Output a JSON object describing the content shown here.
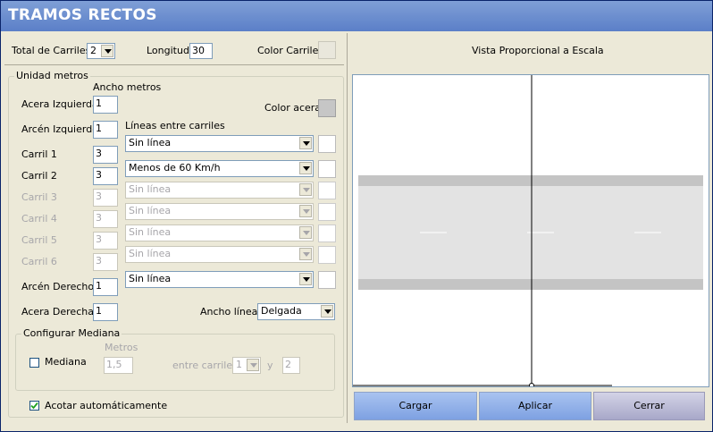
{
  "window": {
    "title": "TRAMOS RECTOS"
  },
  "top": {
    "total_carriles_label": "Total de Carriles:",
    "total_carriles_value": "2",
    "longitud_label": "Longitud:",
    "longitud_value": "30",
    "color_carriles_label": "Color Carriles:",
    "vista_label": "Vista Proporcional a Escala"
  },
  "unidad": {
    "caption": "Unidad metros",
    "ancho_header": "Ancho metros",
    "color_acera_label": "Color acera",
    "lineas_header": "Líneas entre carriles",
    "rows": [
      {
        "label": "Acera Izquierda",
        "value": "1"
      },
      {
        "label": "Arcén Izquierdo",
        "value": "1"
      },
      {
        "label": "Carril 1",
        "value": "3"
      },
      {
        "label": "Carril 2",
        "value": "3"
      },
      {
        "label": "Carril 3",
        "value": "3"
      },
      {
        "label": "Carril 4",
        "value": "3"
      },
      {
        "label": "Carril 5",
        "value": "3"
      },
      {
        "label": "Carril 6",
        "value": "3"
      },
      {
        "label": "Arcén Derecho",
        "value": "1"
      },
      {
        "label": "Acera Derecha",
        "value": "1"
      }
    ],
    "lineas": [
      "Sin línea",
      "Menos de 60 Km/h",
      "Sin línea",
      "Sin línea",
      "Sin línea",
      "Sin línea",
      "Sin línea"
    ],
    "ancho_linea_label": "Ancho línea:",
    "ancho_linea_value": "Delgada"
  },
  "mediana": {
    "caption": "Configurar Mediana",
    "checkbox_label": "Mediana",
    "metros_label": "Metros",
    "metros_value": "1,5",
    "entre_label": "entre carriles",
    "entre_value": "1",
    "y_label": "y",
    "y_value": "2"
  },
  "acotar": {
    "label": "Acotar automáticamente",
    "checked": true
  },
  "buttons": {
    "cargar": "Cargar",
    "aplicar": "Aplicar",
    "cerrar": "Cerrar"
  },
  "colors": {
    "road": "#e3e3e3",
    "shoulder": "#c4c4c4",
    "lane_mark": "#ffffff"
  }
}
